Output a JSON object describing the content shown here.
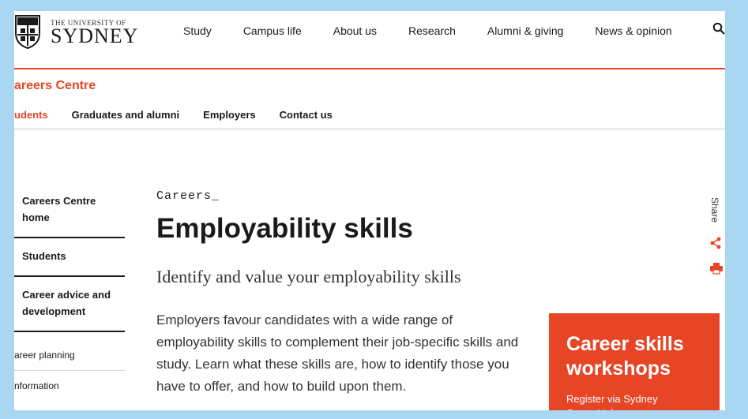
{
  "header": {
    "logo_small": "THE UNIVERSITY OF",
    "logo_big": "SYDNEY",
    "nav": [
      "Study",
      "Campus life",
      "About us",
      "Research",
      "Alumni & giving",
      "News & opinion"
    ]
  },
  "section": {
    "title": "areers Centre",
    "subnav": [
      {
        "label": "udents",
        "active": true
      },
      {
        "label": "Graduates and alumni",
        "active": false
      },
      {
        "label": "Employers",
        "active": false
      },
      {
        "label": "Contact us",
        "active": false
      }
    ]
  },
  "sidebar": {
    "items": [
      "Careers Centre home",
      "Students",
      "Career advice and development"
    ],
    "sub_items": [
      "areer planning",
      "nformation"
    ]
  },
  "main": {
    "kicker": "Careers_",
    "title": "Employability skills",
    "lead": "Identify and value your employability skills",
    "body": "Employers favour candidates with a wide range of employability skills to complement their job-specific skills and study. Learn what these skills are, how to identify those you have to offer, and how to build upon them."
  },
  "share": {
    "label": "Share"
  },
  "promo": {
    "title": "Career skills workshops",
    "subtitle": "Register via Sydney CareerHub"
  },
  "colors": {
    "accent": "#e64626",
    "frame": "#a9d6f0"
  }
}
